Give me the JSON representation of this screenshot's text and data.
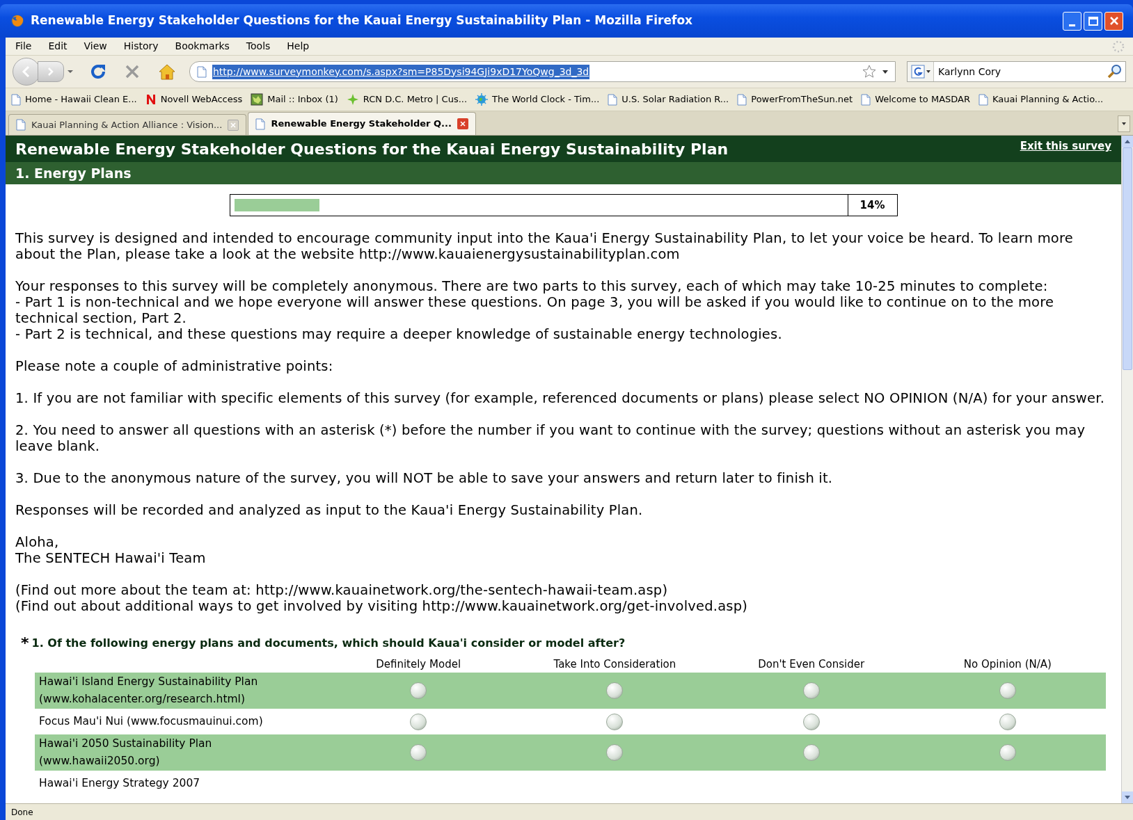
{
  "window": {
    "title": "Renewable Energy Stakeholder Questions for the Kauai Energy Sustainability Plan - Mozilla Firefox"
  },
  "menu": [
    "File",
    "Edit",
    "View",
    "History",
    "Bookmarks",
    "Tools",
    "Help"
  ],
  "address_bar": {
    "value": "http://www.surveymonkey.com/s.aspx?sm=P85Dysi94GJi9xD17YoQwg_3d_3d"
  },
  "search_field": {
    "value": "Karlynn Cory"
  },
  "bookmarks": [
    {
      "label": "Home - Hawaii Clean E...",
      "kind": "page"
    },
    {
      "label": "Novell WebAccess",
      "kind": "novell"
    },
    {
      "label": "Mail :: Inbox (1)",
      "kind": "mail"
    },
    {
      "label": "RCN D.C. Metro | Cus...",
      "kind": "star"
    },
    {
      "label": "The World Clock - Tim...",
      "kind": "globe"
    },
    {
      "label": "U.S. Solar Radiation R...",
      "kind": "page"
    },
    {
      "label": "PowerFromTheSun.net",
      "kind": "page"
    },
    {
      "label": "Welcome to MASDAR",
      "kind": "page"
    },
    {
      "label": "Kauai Planning & Actio...",
      "kind": "page"
    }
  ],
  "tabs": [
    {
      "label": "Kauai Planning & Action Alliance : Vision...",
      "selected": false
    },
    {
      "label": "Renewable Energy Stakeholder Q...",
      "selected": true
    }
  ],
  "survey": {
    "title": "Renewable Energy Stakeholder Questions for the Kauai Energy Sustainability Plan",
    "exit_link": "Exit this survey",
    "section": "1. Energy Plans",
    "progress": {
      "level": 0.14,
      "reading": "14%"
    },
    "paragraphs": [
      [
        "This survey is designed and intended to encourage community input into the Kaua'i Energy Sustainability Plan, to let your voice be heard. To learn more about the Plan, please take a look at the website http://www.kauaienergysustainabilityplan.com"
      ],
      [
        "Your responses to this survey will be completely anonymous. There are two parts to this survey, each of which may take 10-25 minutes to complete:",
        "- Part 1 is non-technical and we hope everyone will answer these questions. On page 3, you will be asked if you would like to continue on to the more technical section, Part 2.",
        "- Part 2 is technical, and these questions may require a deeper knowledge of sustainable energy technologies."
      ],
      [
        "Please note a couple of administrative points:"
      ],
      [
        "1. If you are not familiar with specific elements of this survey (for example, referenced documents or plans) please select NO OPINION (N/A) for your answer."
      ],
      [
        "2. You need to answer all questions with an asterisk (*) before the number if you want to continue with the survey; questions without an asterisk you may leave blank."
      ],
      [
        "3. Due to the anonymous nature of the survey, you will NOT be able to save your answers and return later to finish it."
      ],
      [
        "Responses will be recorded and analyzed as input to the Kaua'i Energy Sustainability Plan."
      ],
      [
        "Aloha,",
        "The SENTECH Hawai'i Team"
      ],
      [
        "(Find out more about the team at: http://www.kauainetwork.org/the-sentech-hawaii-team.asp)",
        "(Find out about additional ways to get involved by visiting http://www.kauainetwork.org/get-involved.asp)"
      ]
    ],
    "question": {
      "required_mark": "*",
      "text": "1. Of the following energy plans and documents, which should Kaua'i consider or model after?",
      "columns": [
        "Definitely Model",
        "Take Into Consideration",
        "Don't Even Consider",
        "No Opinion (N/A)"
      ],
      "rows": [
        {
          "label": "Hawai'i Island Energy Sustainability Plan (www.kohalacenter.org/research.html)",
          "options": [
            {
              "selected": false
            },
            {
              "selected": false
            },
            {
              "selected": false
            },
            {
              "selected": false
            }
          ]
        },
        {
          "label": "Focus Mau'i Nui (www.focusmauinui.com)",
          "options": [
            {
              "selected": false
            },
            {
              "selected": false
            },
            {
              "selected": false
            },
            {
              "selected": false
            }
          ]
        },
        {
          "label": "Hawai'i 2050 Sustainability Plan (www.hawaii2050.org)",
          "options": [
            {
              "selected": false
            },
            {
              "selected": false
            },
            {
              "selected": false
            },
            {
              "selected": false
            }
          ]
        },
        {
          "label": "Hawai'i Energy Strategy 2007"
        }
      ]
    }
  },
  "status_bar": "Done"
}
